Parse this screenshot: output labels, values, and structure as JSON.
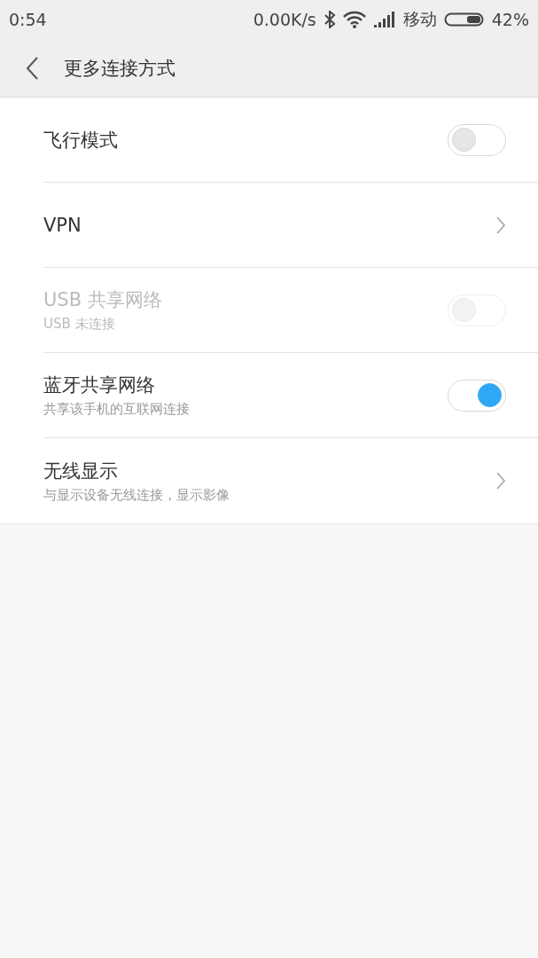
{
  "status_bar": {
    "time": "0:54",
    "speed": "0.00K/s",
    "carrier": "移动",
    "battery": "42%"
  },
  "header": {
    "title": "更多连接方式"
  },
  "items": [
    {
      "kind": "toggle",
      "title": "飞行模式",
      "on": false,
      "disabled": false
    },
    {
      "kind": "link",
      "title": "VPN"
    },
    {
      "kind": "toggle",
      "title": "USB 共享网络",
      "subtitle": "USB 未连接",
      "on": false,
      "disabled": true
    },
    {
      "kind": "toggle",
      "title": "蓝牙共享网络",
      "subtitle": "共享该手机的互联网连接",
      "on": true,
      "disabled": false
    },
    {
      "kind": "link",
      "title": "无线显示",
      "subtitle": "与显示设备无线连接，显示影像"
    }
  ]
}
